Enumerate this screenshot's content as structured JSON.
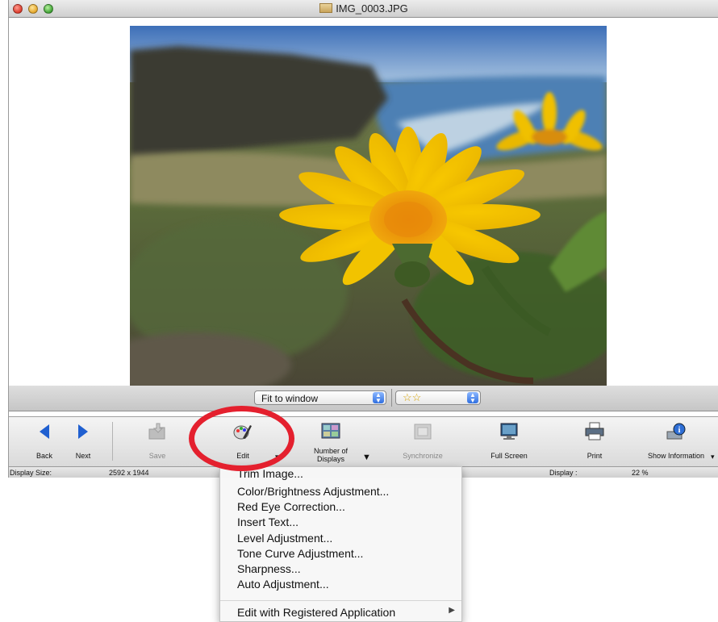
{
  "window": {
    "title": "IMG_0003.JPG"
  },
  "viewbar": {
    "zoom": "Fit to window",
    "rating": "☆☆"
  },
  "toolbar": {
    "back": "Back",
    "next": "Next",
    "save": "Save",
    "edit": "Edit",
    "displays_line1": "Number of",
    "displays_line2": "Displays",
    "sync": "Synchronize",
    "fullscreen": "Full Screen",
    "print": "Print",
    "info": "Show Information"
  },
  "status": {
    "size_label": "Display Size:",
    "size_value": "2592 x 1944",
    "display_label": "Display :",
    "display_value": "22 %"
  },
  "menu": {
    "items": [
      "Trim Image...",
      "Color/Brightness Adjustment...",
      "Red Eye Correction...",
      "Insert Text...",
      "Level Adjustment...",
      "Tone Curve Adjustment...",
      "Sharpness...",
      "Auto Adjustment..."
    ],
    "registered": "Edit with Registered Application"
  },
  "colors": {
    "annotation": "#e4202e",
    "flower": "#f5c400"
  }
}
